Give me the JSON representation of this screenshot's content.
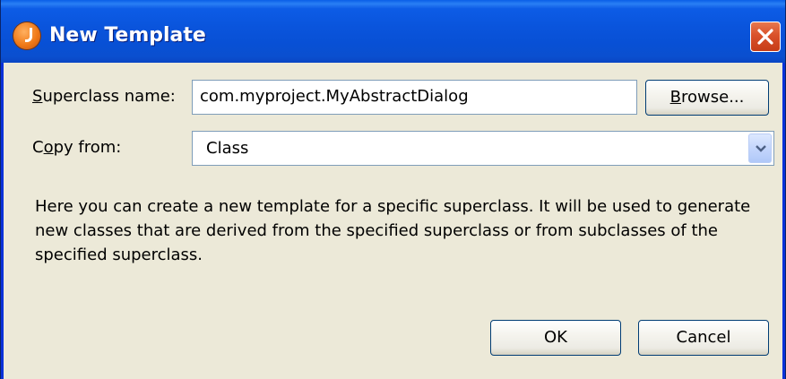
{
  "window": {
    "title": "New Template",
    "app_icon": "jdeveloper-app-icon",
    "close_icon": "close-icon"
  },
  "form": {
    "superclass_label_mnemonic": "S",
    "superclass_label_rest": "uperclass name:",
    "superclass_value": "com.myproject.MyAbstractDialog",
    "browse_label_mnemonic": "B",
    "browse_label_rest": "rowse...",
    "copy_from_label_start": "C",
    "copy_from_label_mnemonic": "o",
    "copy_from_label_rest": "py from:",
    "copy_from_selected": "Class"
  },
  "description": "Here you can create a new template for a specific superclass. It will be used to generate new classes that are derived from the specified superclass or from subclasses of the specified superclass.",
  "buttons": {
    "ok": "OK",
    "cancel": "Cancel"
  },
  "colors": {
    "titlebar": "#0a55dd",
    "client_background": "#ece9d8",
    "close_button": "#d9512a",
    "field_border": "#7f9db9"
  }
}
